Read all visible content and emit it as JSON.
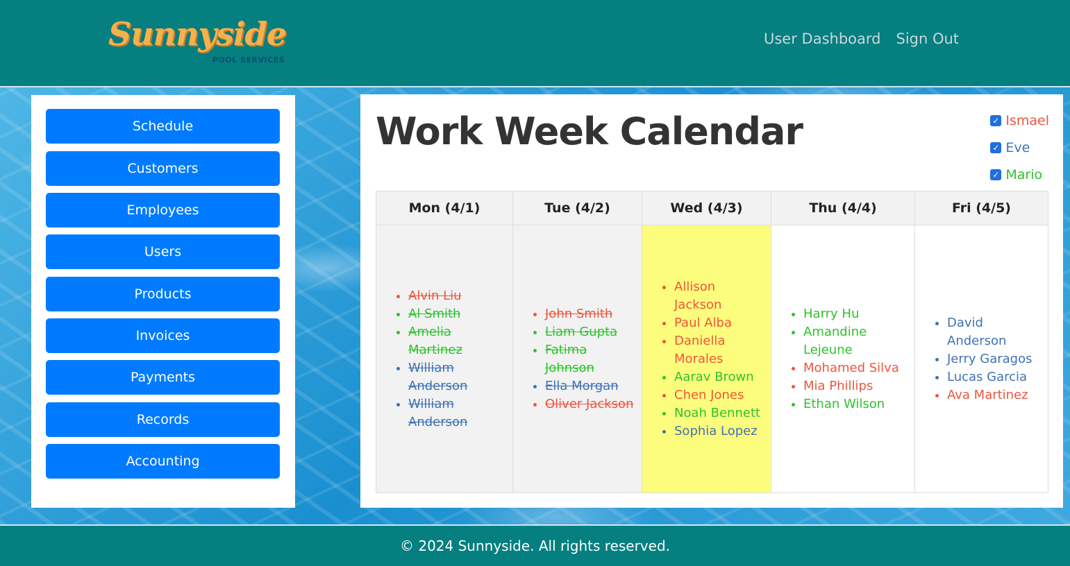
{
  "brand": {
    "name": "Sunnyside",
    "tagline": "POOL SERVICES"
  },
  "nav": {
    "dashboard": "User Dashboard",
    "signout": "Sign Out"
  },
  "sidebar": {
    "items": [
      {
        "label": "Schedule"
      },
      {
        "label": "Customers"
      },
      {
        "label": "Employees"
      },
      {
        "label": "Users"
      },
      {
        "label": "Products"
      },
      {
        "label": "Invoices"
      },
      {
        "label": "Payments"
      },
      {
        "label": "Records"
      },
      {
        "label": "Accounting"
      }
    ]
  },
  "main": {
    "title": "Work Week Calendar",
    "filters": [
      {
        "label": "Ismael",
        "checked": true,
        "color": "#f0543c"
      },
      {
        "label": "Eve",
        "checked": true,
        "color": "#3f72b4"
      },
      {
        "label": "Mario",
        "checked": true,
        "color": "#2ec22e"
      }
    ],
    "days": [
      {
        "header": "Mon (4/1)",
        "state": "past",
        "entries": [
          {
            "name": "Alvin Liu",
            "employee": "Ismael"
          },
          {
            "name": "Al Smith",
            "employee": "Mario"
          },
          {
            "name": "Amelia Martinez",
            "employee": "Mario"
          },
          {
            "name": "William Anderson",
            "employee": "Eve"
          },
          {
            "name": "William Anderson",
            "employee": "Eve"
          }
        ]
      },
      {
        "header": "Tue (4/2)",
        "state": "past",
        "entries": [
          {
            "name": "John Smith",
            "employee": "Ismael"
          },
          {
            "name": "Liam Gupta",
            "employee": "Mario"
          },
          {
            "name": "Fatima Johnson",
            "employee": "Mario"
          },
          {
            "name": "Ella Morgan",
            "employee": "Eve"
          },
          {
            "name": "Oliver Jackson",
            "employee": "Ismael"
          }
        ]
      },
      {
        "header": "Wed (4/3)",
        "state": "today",
        "entries": [
          {
            "name": "Allison Jackson",
            "employee": "Ismael"
          },
          {
            "name": "Paul Alba",
            "employee": "Ismael"
          },
          {
            "name": "Daniella Morales",
            "employee": "Ismael"
          },
          {
            "name": "Aarav Brown",
            "employee": "Mario"
          },
          {
            "name": "Chen Jones",
            "employee": "Ismael"
          },
          {
            "name": "Noah Bennett",
            "employee": "Mario"
          },
          {
            "name": "Sophia Lopez",
            "employee": "Eve"
          }
        ]
      },
      {
        "header": "Thu (4/4)",
        "state": "future",
        "entries": [
          {
            "name": "Harry Hu",
            "employee": "Mario"
          },
          {
            "name": "Amandine Lejeune",
            "employee": "Mario"
          },
          {
            "name": "Mohamed Silva",
            "employee": "Ismael"
          },
          {
            "name": "Mia Phillips",
            "employee": "Ismael"
          },
          {
            "name": "Ethan Wilson",
            "employee": "Mario"
          }
        ]
      },
      {
        "header": "Fri (4/5)",
        "state": "future",
        "entries": [
          {
            "name": "David Anderson",
            "employee": "Eve"
          },
          {
            "name": "Jerry Garagos",
            "employee": "Eve"
          },
          {
            "name": "Lucas Garcia",
            "employee": "Eve"
          },
          {
            "name": "Ava Martinez",
            "employee": "Ismael"
          }
        ]
      }
    ]
  },
  "footer": {
    "text": "© 2024 Sunnyside. All rights reserved."
  }
}
